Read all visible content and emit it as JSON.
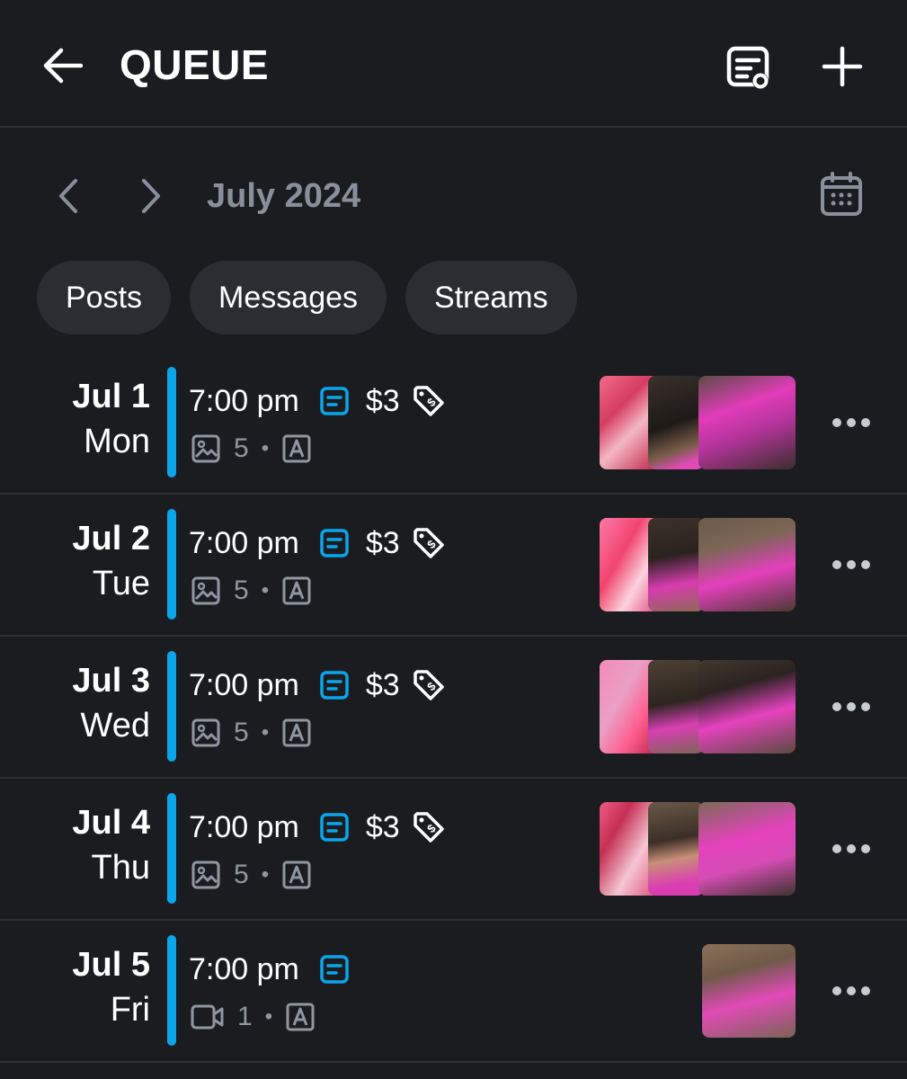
{
  "header": {
    "title": "QUEUE"
  },
  "month_nav": {
    "label": "July 2024"
  },
  "filters": [
    {
      "label": "Posts"
    },
    {
      "label": "Messages"
    },
    {
      "label": "Streams"
    }
  ],
  "colors": {
    "accent": "#0aa5ea",
    "background": "#1b1c20",
    "chip": "#2b2d33",
    "muted": "#8a909b"
  },
  "queue": [
    {
      "date": "Jul 1",
      "weekday": "Mon",
      "time": "7:00 pm",
      "price": "$3",
      "media_icon": "image-icon",
      "media_count": "5",
      "separator": "•"
    },
    {
      "date": "Jul 2",
      "weekday": "Tue",
      "time": "7:00 pm",
      "price": "$3",
      "media_icon": "image-icon",
      "media_count": "5",
      "separator": "•"
    },
    {
      "date": "Jul 3",
      "weekday": "Wed",
      "time": "7:00 pm",
      "price": "$3",
      "media_icon": "image-icon",
      "media_count": "5",
      "separator": "•"
    },
    {
      "date": "Jul 4",
      "weekday": "Thu",
      "time": "7:00 pm",
      "price": "$3",
      "media_icon": "image-icon",
      "media_count": "5",
      "separator": "•"
    },
    {
      "date": "Jul 5",
      "weekday": "Fri",
      "time": "7:00 pm",
      "price": "",
      "media_icon": "video-icon",
      "media_count": "1",
      "separator": "•"
    }
  ]
}
